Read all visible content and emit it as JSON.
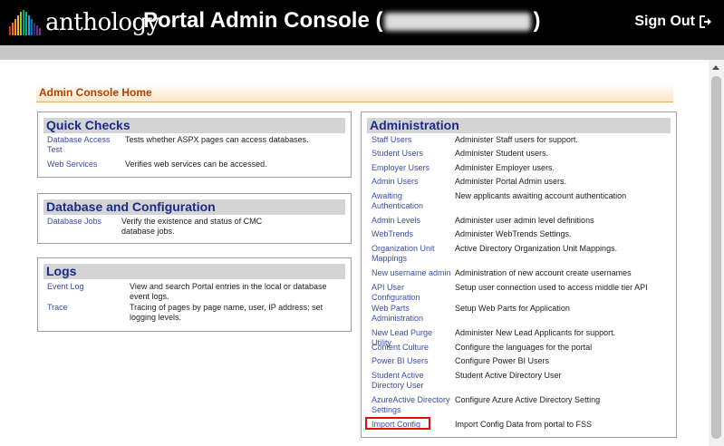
{
  "header": {
    "logo_text": "anthology",
    "title_prefix": "Portal Admin Console (",
    "title_suffix": ")",
    "sign_out": "Sign Out",
    "logo_colors": [
      "#e2231a",
      "#f26522",
      "#f7941d",
      "#fdb913",
      "#8dc63f",
      "#00a651",
      "#00a99d",
      "#00aeef",
      "#0072bc",
      "#2e3192",
      "#662d91",
      "#92278f"
    ]
  },
  "breadcrumb": "Admin Console Home",
  "quick_checks": {
    "title": "Quick Checks",
    "items": [
      {
        "label": "Database Access Test",
        "desc": "Tests whether ASPX pages can access databases."
      },
      {
        "label": "Web Services",
        "desc": "Verifies web services can be accessed."
      }
    ]
  },
  "db_config": {
    "title": "Database and Configuration",
    "items": [
      {
        "label": "Database Jobs",
        "desc": "Verify the existence and status of CMC database jobs."
      }
    ]
  },
  "logs": {
    "title": "Logs",
    "items": [
      {
        "label": "Event Log",
        "desc": "View and search Portal entries in the local or database event logs."
      },
      {
        "label": "Trace",
        "desc": "Tracing of pages by page name, user, IP address; set logging levels."
      }
    ]
  },
  "administration": {
    "title": "Administration",
    "items": [
      {
        "label": "Staff Users",
        "desc": "Administer Staff users for support."
      },
      {
        "label": "Student Users",
        "desc": "Administer Student users."
      },
      {
        "label": "Employer Users",
        "desc": "Administer Employer users."
      },
      {
        "label": "Admin Users",
        "desc": "Administer Portal Admin users."
      },
      {
        "label": "Awaiting Authentication",
        "desc": "New applicants awaiting account authentication"
      },
      {
        "label": "Admin Levels",
        "desc": "Administer user admin level definitions"
      },
      {
        "label": "WebTrends",
        "desc": "Administer WebTrends Settings."
      },
      {
        "label": "Organization Unit Mappings",
        "desc": "Active Directory Organization Unit Mappings."
      },
      {
        "label": "New username admin",
        "desc": "Administration of new account create usernames"
      },
      {
        "label": "API User Configuration",
        "desc": "Setup user connection used to access middle tier API"
      },
      {
        "label": "Web Parts Administration",
        "desc": "Setup Web Parts for Application"
      },
      {
        "label": "New Lead Purge Utility",
        "desc": "Administer New Lead Applicants for support."
      },
      {
        "label": "Content Culture",
        "desc": "Configure the languages for the portal"
      },
      {
        "label": "Power BI Users",
        "desc": "Configure Power BI Users"
      },
      {
        "label": "Student Active Directory User",
        "desc": "Student Active Directory User"
      },
      {
        "label": "AzureActive Directory Settings",
        "desc": "Configure Azure Active Directory Setting"
      },
      {
        "label": "Import Config",
        "desc": "Import Config Data from portal to FSS"
      }
    ]
  }
}
